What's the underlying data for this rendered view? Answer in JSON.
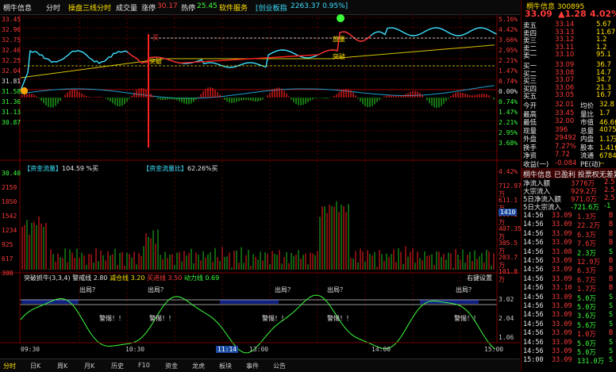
{
  "topbar": {
    "stock_name": "桐牛信息",
    "tab_tick": "分时",
    "tab_overlay": "操盘三线分时",
    "ind_volume": "成交量",
    "ind_change": "涨停",
    "val_change": "30.17",
    "ind_hot": "热停",
    "val_hot": "25.45",
    "ind_service": "软件服务",
    "board_label": "[创业板指",
    "board_val": "2263.37 0.95%]"
  },
  "header_right": {
    "title": "桐牛信息 300895",
    "price": "33.09",
    "change": "▲1.28",
    "pct": "4.02%"
  },
  "y_price_labels": [
    "33.45",
    "32.96",
    "32.75",
    "32.46",
    "32.25",
    "32.04",
    "31.81",
    "31.58",
    "31.36",
    "31.13",
    "30.87"
  ],
  "y_pct_labels": [
    "5.16%",
    "4.42%",
    "3.66%",
    "2.95%",
    "2.21%",
    "1.47%",
    "0.74%",
    "0.00%",
    "0.74%",
    "1.47%",
    "2.21%",
    "2.95%",
    "3.68%"
  ],
  "fund_bar": {
    "label1": "【资金流量】",
    "val1": "104.59 %买",
    "label2": "【资金流量比】",
    "val2": "62.26%买",
    "pct_right": "4.42%"
  },
  "y_vol_labels": [
    "30.40",
    "2159",
    "1850",
    "1542",
    "1234",
    "925",
    "617",
    "308"
  ],
  "y_vol_right": [
    "712.97万",
    "611.1万",
    "509.2万",
    "407.35万",
    "305.5万",
    "203.7万",
    "101.8万"
  ],
  "vol_badge": "1410",
  "lower_indicator": {
    "title": "突破抓牛(3,3,4)",
    "lbl1": "警戒线",
    "val1": "2.80",
    "lbl2": "减仓线",
    "val2": "3.20",
    "lbl3": "买进线",
    "val3": "3.50",
    "lbl4": "动力线",
    "val4": "0.69",
    "settings": "右键设置",
    "ticks_right": [
      "3.02",
      "2.04",
      "1.06"
    ],
    "warn": "警惕！！",
    "out": "出局？"
  },
  "annotations": {
    "breakout": "突破",
    "breakout2": "突破",
    "volume": "放量",
    "circle": "买"
  },
  "time_axis": [
    "09:30",
    "10:30",
    "11:14",
    "13:00",
    "14:00",
    "15:00"
  ],
  "bottombar": [
    "分时",
    "日K",
    "周K",
    "月K",
    "历史",
    "F10",
    "资金",
    "龙虎",
    "板块",
    "事件",
    "公告"
  ],
  "order_book": {
    "asks": [
      {
        "label": "卖五",
        "price": "33.14",
        "vol": "5.67"
      },
      {
        "label": "卖四",
        "price": "33.13",
        "vol": "11.67"
      },
      {
        "label": "卖三",
        "price": "33.12",
        "vol": "1.2"
      },
      {
        "label": "卖二",
        "price": "33.11",
        "vol": "1.2"
      },
      {
        "label": "卖一",
        "price": "33.10",
        "vol": "95.1"
      }
    ],
    "bids": [
      {
        "label": "买一",
        "price": "33.09",
        "vol": "36.7"
      },
      {
        "label": "买二",
        "price": "33.08",
        "vol": "14.7"
      },
      {
        "label": "买三",
        "price": "33.07",
        "vol": "34.7"
      },
      {
        "label": "买四",
        "price": "33.06",
        "vol": "21.3"
      },
      {
        "label": "买五",
        "price": "33.05",
        "vol": "16.7"
      }
    ]
  },
  "quote_stats": [
    {
      "l": "今开",
      "v": "32.01",
      "l2": "均价",
      "v2": "32.8"
    },
    {
      "l": "最高",
      "v": "33.45",
      "l2": "量比",
      "v2": "1.7"
    },
    {
      "l": "最低",
      "v": "32.00",
      "l2": "市值",
      "v2": "46.6亿"
    },
    {
      "l": "现量",
      "v": "396",
      "l2": "总量",
      "v2": "4075"
    },
    {
      "l": "外盘",
      "v": "29492",
      "l2": "内盘",
      "v2": "1.1万"
    },
    {
      "l": "换手",
      "v": "7.27%",
      "l2": "股本",
      "v2": "1.41亿"
    },
    {
      "l": "净资",
      "v": "7.72",
      "l2": "流通",
      "v2": "6784万"
    },
    {
      "l": "收益(一)",
      "v": "-0.084",
      "l2": "PE(动)",
      "v2": "--"
    }
  ],
  "info_line": "桐牛信息 已盈利 投票权无差异",
  "flows": [
    {
      "l": "净流入额",
      "v": "3776万",
      "v2": "2.5"
    },
    {
      "l": "大宗流入",
      "v": "929.2万",
      "v2": "2.5"
    },
    {
      "l": "5日净流入额",
      "v": "971.0万",
      "v2": "2.5"
    },
    {
      "l": "5日大宗流入",
      "v": "-721.6万",
      "v2": "-1"
    }
  ],
  "ticks": [
    {
      "t": "14:56",
      "p": "33.09",
      "v": "1.3万",
      "d": "B"
    },
    {
      "t": "14:56",
      "p": "33.09",
      "v": "22.2万",
      "d": "B"
    },
    {
      "t": "14:56",
      "p": "33.09",
      "v": "6.3万",
      "d": "B"
    },
    {
      "t": "14:56",
      "p": "33.09",
      "v": "7.6万",
      "d": "B"
    },
    {
      "t": "14:56",
      "p": "33.08",
      "v": "2.3万",
      "d": "S"
    },
    {
      "t": "14:56",
      "p": "33.09",
      "v": "12.9万",
      "d": "B"
    },
    {
      "t": "14:56",
      "p": "33.09",
      "v": "6.3万",
      "d": "B"
    },
    {
      "t": "14:56",
      "p": "33.09",
      "v": "6.7万",
      "d": "B"
    },
    {
      "t": "14:56",
      "p": "33.10",
      "v": "1.7万",
      "d": "B"
    },
    {
      "t": "14:56",
      "p": "33.09",
      "v": "5.0万",
      "d": "S"
    },
    {
      "t": "14:56",
      "p": "33.09",
      "v": "5.0万",
      "d": "S"
    },
    {
      "t": "14:56",
      "p": "33.09",
      "v": "3.6万",
      "d": "S"
    },
    {
      "t": "14:56",
      "p": "33.09",
      "v": "5.6万",
      "d": "S"
    },
    {
      "t": "14:56",
      "p": "33.09",
      "v": "1.0万",
      "d": "B"
    },
    {
      "t": "14:56",
      "p": "33.09",
      "v": "5.0万",
      "d": "S"
    },
    {
      "t": "14:56",
      "p": "33.09",
      "v": "5.0万",
      "d": "S"
    },
    {
      "t": "15:00",
      "p": "33.09",
      "v": "131.0万",
      "d": "S"
    }
  ],
  "colors": {
    "up": "#ff3a3a",
    "down": "#3cff3c",
    "price_line": "#3ce0ff",
    "avg_line": "#ffe000",
    "grid": "#7a0000"
  }
}
